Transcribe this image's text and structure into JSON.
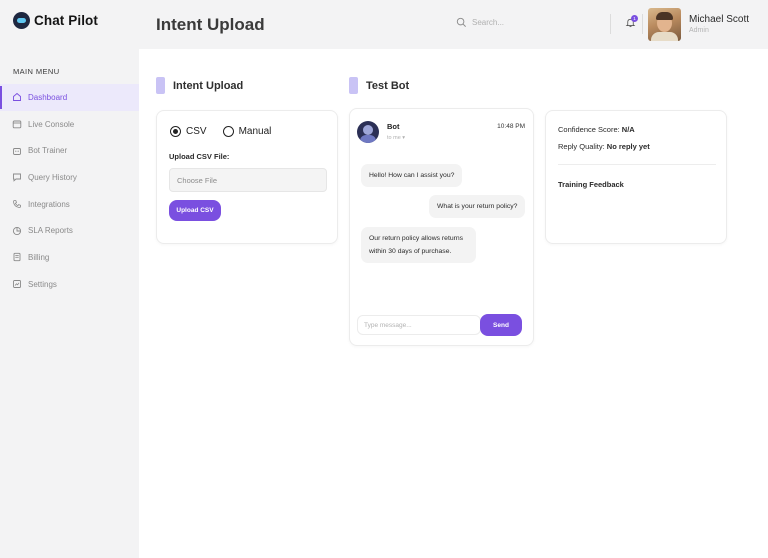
{
  "brand": {
    "name": "Chat Pilot",
    "accent": "#7a4fe0"
  },
  "sidebar": {
    "menu_title": "MAIN MENU",
    "items": [
      {
        "label": "Dashboard",
        "icon": "home-icon",
        "active": true
      },
      {
        "label": "Live Console",
        "icon": "calendar-icon"
      },
      {
        "label": "Bot Trainer",
        "icon": "bot-icon"
      },
      {
        "label": "Query History",
        "icon": "chat-icon"
      },
      {
        "label": "Integrations",
        "icon": "phone-icon"
      },
      {
        "label": "SLA Reports",
        "icon": "chart-icon"
      },
      {
        "label": "Billing",
        "icon": "billing-icon"
      },
      {
        "label": "Settings",
        "icon": "settings-icon"
      }
    ]
  },
  "header": {
    "title": "Intent Upload",
    "search_placeholder": "Search...",
    "notification_count": "1",
    "user": {
      "name": "Michael Scott",
      "role": "Admin"
    }
  },
  "intent_upload": {
    "title": "Intent Upload",
    "options": [
      "CSV",
      "Manual"
    ],
    "selected": "CSV",
    "upload_label": "Upload CSV File:",
    "file_placeholder": "Choose File",
    "upload_button": "Upload CSV"
  },
  "test_bot": {
    "title": "Test Bot",
    "bot_name": "Bot",
    "bot_sub": "to me",
    "time": "10:48 PM",
    "messages": [
      {
        "from": "bot",
        "text": "Hello! How can I assist you?"
      },
      {
        "from": "user",
        "text": "What is your return policy?"
      },
      {
        "from": "bot",
        "text": "Our return policy allows returns within 30 days of purchase."
      }
    ],
    "input_placeholder": "Type message...",
    "send_button": "Send"
  },
  "scores": {
    "confidence_label": "Confidence Score:",
    "confidence_value": "N/A",
    "reply_label": "Reply Quality:",
    "reply_value": "No reply yet",
    "feedback_title": "Training Feedback"
  }
}
